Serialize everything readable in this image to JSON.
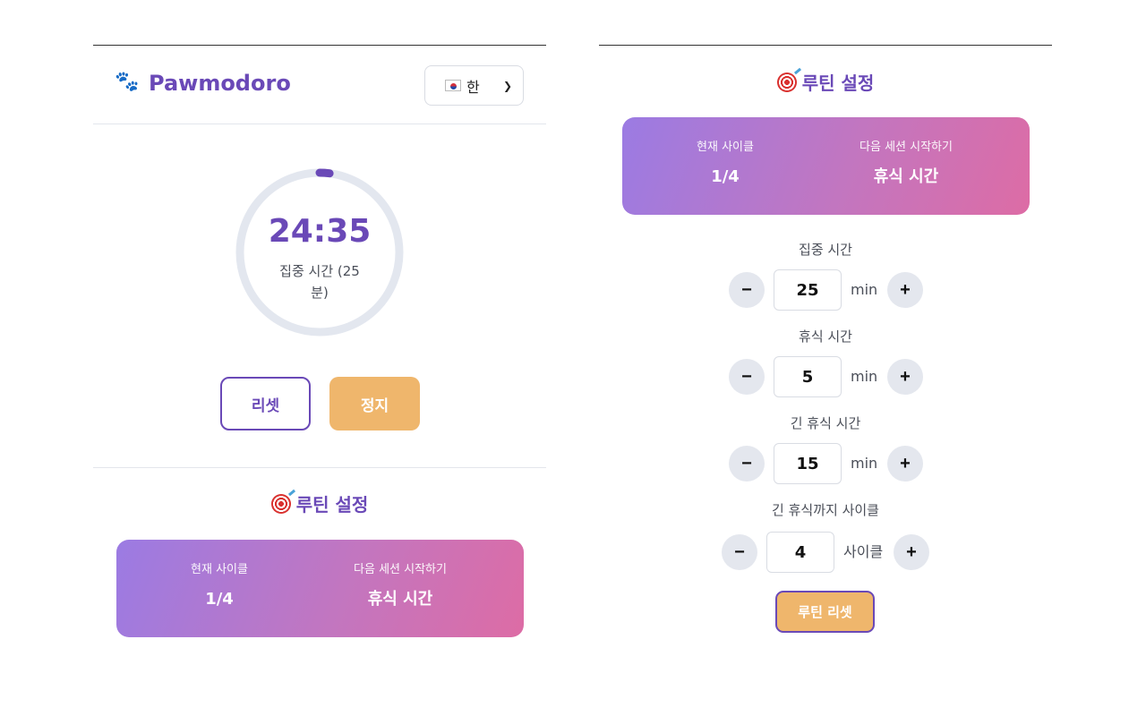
{
  "app": {
    "title": "Pawmodoro",
    "logo_icon": "paw-icon",
    "language": {
      "selected": "한",
      "flag_icon": "korea-flag-icon"
    }
  },
  "timer": {
    "time": "24:35",
    "mode_label": "집중 시간 (25 분)",
    "progress_fraction": 0.02,
    "ring_color": "#6a49b7",
    "track_color": "#e3e7ef"
  },
  "controls": {
    "reset_label": "리셋",
    "stop_label": "정지"
  },
  "routine": {
    "title": "루틴 설정",
    "title_icon": "target-icon",
    "current_cycle_label": "현재 사이클",
    "current_cycle_value": "1/4",
    "next_session_label": "다음 세션 시작하기",
    "next_session_value": "휴식 시간"
  },
  "settings": {
    "focus": {
      "label": "집중 시간",
      "value": "25",
      "unit": "min"
    },
    "break": {
      "label": "휴식 시간",
      "value": "5",
      "unit": "min"
    },
    "long_break": {
      "label": "긴 휴식 시간",
      "value": "15",
      "unit": "min"
    },
    "cycles": {
      "label": "긴 휴식까지 사이클",
      "value": "4",
      "unit": "사이클"
    },
    "minus_label": "−",
    "plus_label": "+",
    "reset_routine_label": "루틴 리셋"
  },
  "colors": {
    "brand": "#6a49b7",
    "accent": "#efb66c",
    "gradient_start": "#9b7be3",
    "gradient_end": "#dd6ca5"
  }
}
